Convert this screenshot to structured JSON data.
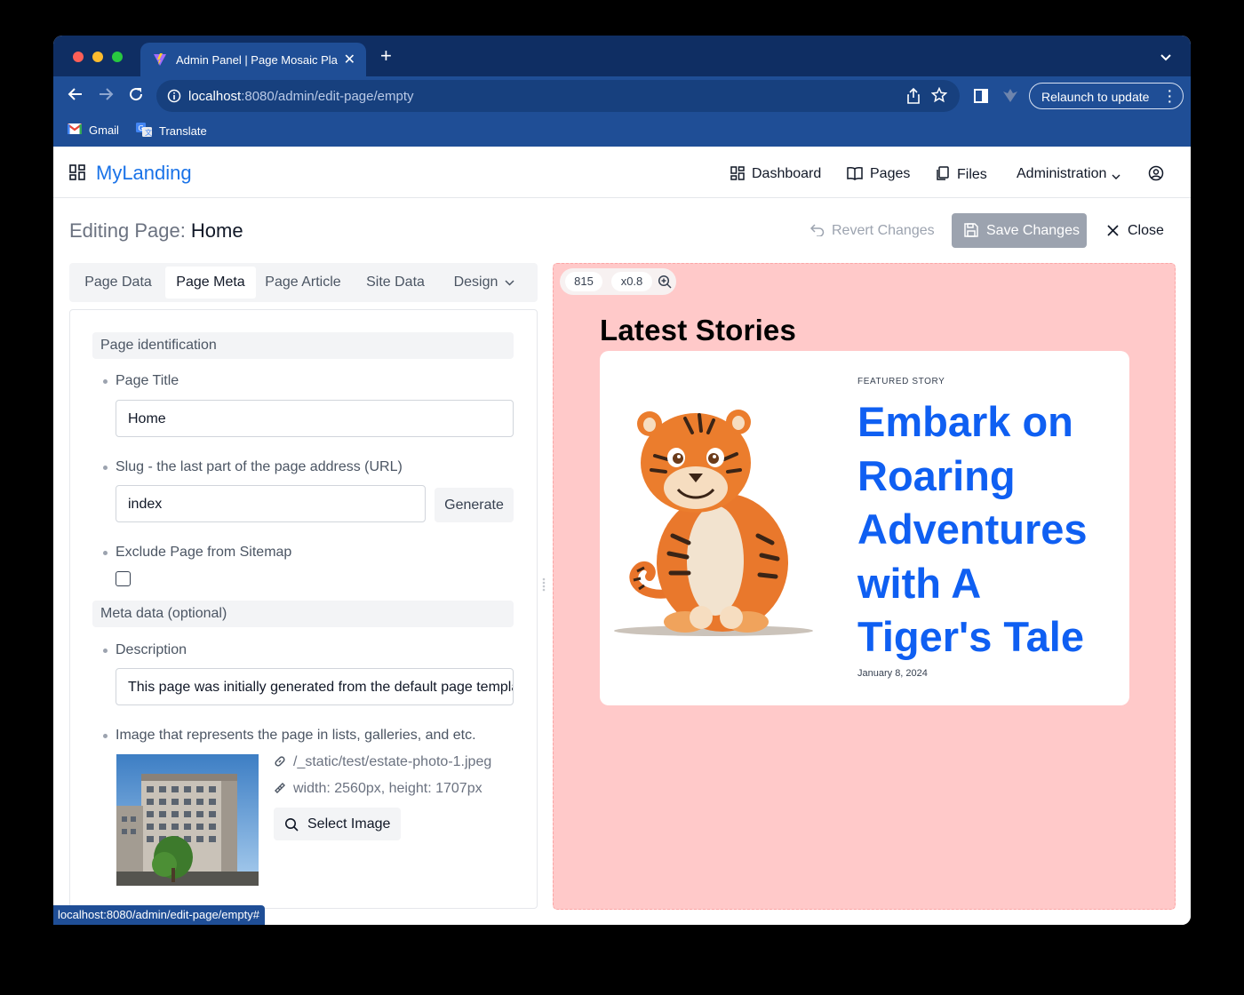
{
  "browser": {
    "tab_title": "Admin Panel | Page Mosaic Pla",
    "url_host": "localhost",
    "url_path": ":8080/admin/edit-page/empty",
    "relaunch_label": "Relaunch to update",
    "bookmarks": [
      {
        "label": "Gmail",
        "icon": "gmail-icon"
      },
      {
        "label": "Translate",
        "icon": "translate-icon"
      }
    ],
    "status_url": "localhost:8080/admin/edit-page/empty#"
  },
  "app": {
    "logo": "MyLanding",
    "nav": [
      {
        "label": "Dashboard",
        "icon": "dashboard-icon"
      },
      {
        "label": "Pages",
        "icon": "book-icon"
      },
      {
        "label": "Files",
        "icon": "files-icon"
      },
      {
        "label": "Administration",
        "icon": "chevron-down-icon"
      }
    ]
  },
  "editor": {
    "heading_prefix": "Editing Page:",
    "page_name": "Home",
    "revert_label": "Revert Changes",
    "save_label": "Save Changes",
    "close_label": "Close",
    "tabs": [
      "Page Data",
      "Page Meta",
      "Page Article",
      "Site Data",
      "Design"
    ],
    "active_tab": "Page Meta"
  },
  "form": {
    "section_identification": "Page identification",
    "page_title_label": "Page Title",
    "page_title_value": "Home",
    "slug_label": "Slug - the last part of the page address (URL)",
    "slug_value": "index",
    "generate_label": "Generate",
    "exclude_label": "Exclude Page from Sitemap",
    "exclude_checked": false,
    "section_meta": "Meta data (optional)",
    "description_label": "Description",
    "description_value": "This page was initially generated from the default page template",
    "image_label": "Image that represents the page in lists, galleries, and etc.",
    "image_path": "/_static/test/estate-photo-1.jpeg",
    "image_dims": "width: 2560px, height: 1707px",
    "select_image_label": "Select Image"
  },
  "preview": {
    "width": "815",
    "zoom": "x0.8",
    "background": "#ffc9c9",
    "section_title": "Latest Stories",
    "featured_label": "FEATURED STORY",
    "headline": "Embark on Roaring Adventures with A Tiger's Tale",
    "date": "January 8, 2024",
    "headline_color": "#0f5ff2"
  }
}
